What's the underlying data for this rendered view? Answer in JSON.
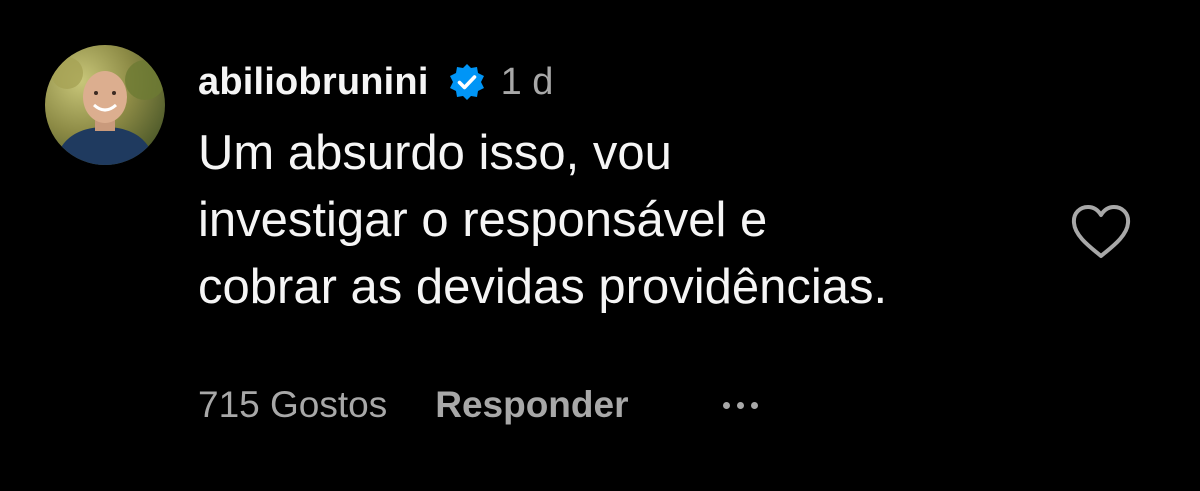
{
  "comment": {
    "username": "abiliobrunini",
    "verified": true,
    "timestamp": "1 d",
    "text_lines": [
      "Um absurdo isso, vou",
      "investigar o responsável e",
      "cobrar as devidas providências."
    ],
    "likes_label": "715 Gostos",
    "reply_label": "Responder",
    "more_icon": "ellipsis-icon",
    "like_icon": "heart-outline-icon",
    "avatar_icon": "avatar-photo"
  },
  "colors": {
    "background": "#000000",
    "primary_text": "#f5f5f5",
    "secondary_text": "#a8a8a8",
    "verified_badge": "#0095f6"
  }
}
